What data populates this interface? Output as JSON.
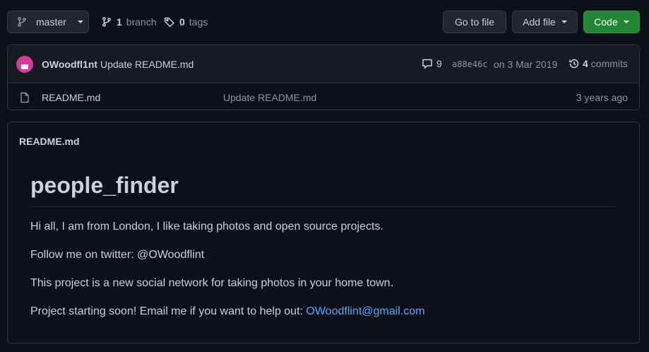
{
  "toolbar": {
    "branch_label": "master",
    "branches_count": "1",
    "branches_label": "branch",
    "tags_count": "0",
    "tags_label": "tags",
    "goto_file": "Go to file",
    "add_file": "Add file",
    "code": "Code"
  },
  "commit": {
    "author": "OWoodfl1nt",
    "message": "Update README.md",
    "comment_count": "9",
    "sha": "a88e46c",
    "date": "on 3 Mar 2019",
    "commits_count": "4",
    "commits_label": "commits"
  },
  "files": [
    {
      "icon": "file-icon",
      "name": "README.md",
      "last_commit": "Update README.md",
      "age": "3 years ago"
    }
  ],
  "readme": {
    "filename": "README.md",
    "heading": "people_finder",
    "paragraphs": [
      "Hi all, I am from London, I like taking photos and open source projects.",
      "Follow me on twitter: @OWoodflint",
      "This project is a new social network for taking photos in your home town.",
      "Project starting soon! Email me if you want to help out: "
    ],
    "email": "OWoodflint@gmail.com"
  },
  "colors": {
    "background": "#0d1117",
    "accent_green": "#238636",
    "link_blue": "#58a6ff",
    "avatar": "#d63b9a"
  }
}
